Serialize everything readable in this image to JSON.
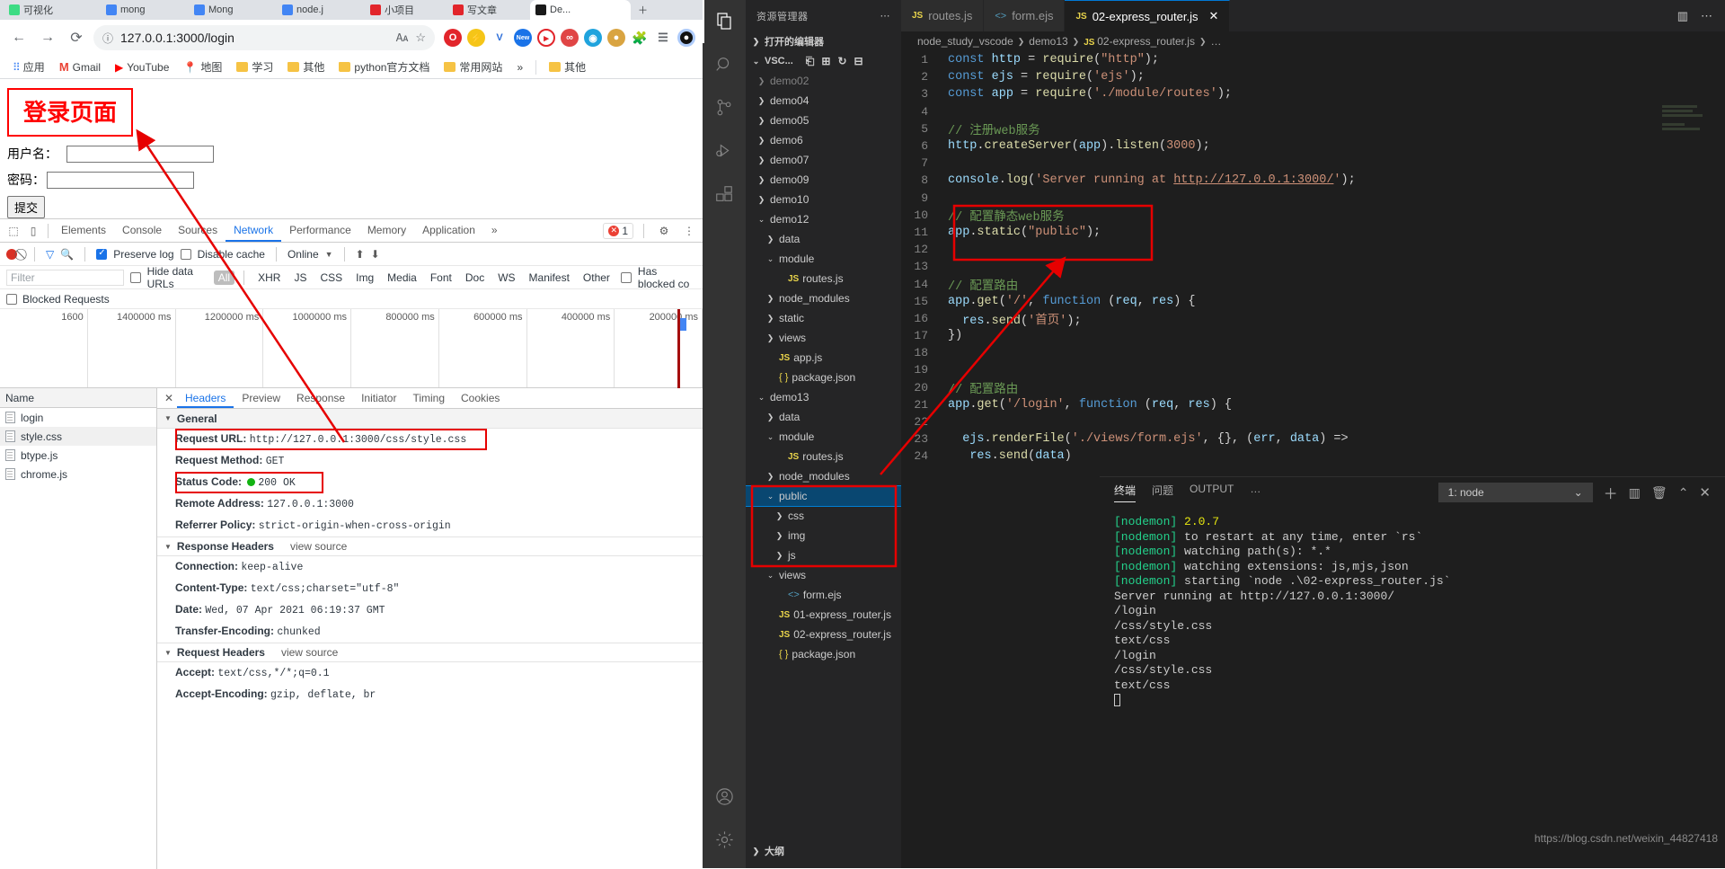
{
  "browser": {
    "tabs": [
      {
        "label": "可视化",
        "active": false
      },
      {
        "label": "mong",
        "active": false
      },
      {
        "label": "Mong",
        "active": false
      },
      {
        "label": "node.j",
        "active": false
      },
      {
        "label": "小项目",
        "active": false
      },
      {
        "label": "写文章",
        "active": false
      },
      {
        "label": "De...",
        "active": true
      }
    ],
    "nav": {
      "back_icon": "back-arrow-icon",
      "forward_icon": "forward-arrow-icon",
      "reload_icon": "reload-icon",
      "info_icon": "info-circle-icon",
      "url": "127.0.0.1:3000/login",
      "translate_icon": "translate-icon",
      "star_icon": "star-icon"
    },
    "extensions": [
      "opera-icon",
      "flash-icon",
      "v-icon",
      "new-badge-icon",
      "circle-icon",
      "infinity-icon",
      "blue-icon",
      "cookie-icon",
      "puzzle-icon",
      "playlist-icon",
      "profile-icon"
    ],
    "bookmarks": [
      {
        "label": "应用",
        "icon": "apps-grid-icon"
      },
      {
        "label": "Gmail",
        "icon": "gmail-icon"
      },
      {
        "label": "YouTube",
        "icon": "youtube-icon"
      },
      {
        "label": "地图",
        "icon": "maps-icon"
      },
      {
        "label": "学习",
        "icon": "folder-icon"
      },
      {
        "label": "其他",
        "icon": "folder-icon"
      },
      {
        "label": "python官方文档",
        "icon": "folder-icon"
      },
      {
        "label": "常用网站",
        "icon": "folder-icon"
      },
      {
        "label": "»",
        "icon": "overflow-icon"
      },
      {
        "label": "其他",
        "icon": "folder-icon"
      }
    ]
  },
  "page": {
    "heading": "登录页面",
    "username_label": "用户名：",
    "password_label": "密码：",
    "username_value": "",
    "password_value": "",
    "submit_label": "提交"
  },
  "devtools": {
    "tabs": [
      {
        "label": "Elements",
        "selected": false
      },
      {
        "label": "Console",
        "selected": false
      },
      {
        "label": "Sources",
        "selected": false
      },
      {
        "label": "Network",
        "selected": true
      },
      {
        "label": "Performance",
        "selected": false
      },
      {
        "label": "Memory",
        "selected": false
      },
      {
        "label": "Application",
        "selected": false
      },
      {
        "label": "»",
        "selected": false
      }
    ],
    "error_count": "1",
    "toolbar": {
      "record_icon": "record-icon",
      "clear_icon": "clear-icon",
      "filter_icon": "filter-icon",
      "search_icon": "search-icon",
      "preserve_log_label": "Preserve log",
      "preserve_log_checked": true,
      "disable_cache_label": "Disable cache",
      "disable_cache_checked": false,
      "throttling_value": "Online",
      "import_icon": "import-arrow-icon",
      "export_icon": "export-arrow-icon"
    },
    "filterbar": {
      "filter_placeholder": "Filter",
      "hide_data_urls_label": "Hide data URLs",
      "hide_data_urls_checked": false,
      "types": [
        "All",
        "XHR",
        "JS",
        "CSS",
        "Img",
        "Media",
        "Font",
        "Doc",
        "WS",
        "Manifest",
        "Other"
      ],
      "selected_type": "All",
      "has_blocked_label": "Has blocked co",
      "has_blocked_checked": false
    },
    "blocked_requests_label": "Blocked Requests",
    "overview_ticks": [
      "200000 ms",
      "400000 ms",
      "600000 ms",
      "800000 ms",
      "1000000 ms",
      "1200000 ms",
      "1400000 ms",
      "1600"
    ],
    "requests_header": "Name",
    "requests": [
      {
        "name": "login",
        "selected": false
      },
      {
        "name": "style.css",
        "selected": true
      },
      {
        "name": "btype.js",
        "selected": false
      },
      {
        "name": "chrome.js",
        "selected": false
      }
    ],
    "detail_tabs": [
      {
        "label": "Headers",
        "selected": true
      },
      {
        "label": "Preview",
        "selected": false
      },
      {
        "label": "Response",
        "selected": false
      },
      {
        "label": "Initiator",
        "selected": false
      },
      {
        "label": "Timing",
        "selected": false
      },
      {
        "label": "Cookies",
        "selected": false
      }
    ],
    "general_title": "General",
    "general": [
      {
        "key": "Request URL:",
        "value": "http://127.0.0.1:3000/css/style.css",
        "highlight": true
      },
      {
        "key": "Request Method:",
        "value": "GET",
        "highlight": false
      },
      {
        "key": "Status Code:",
        "value": "200  OK",
        "highlight": true,
        "status_dot": true
      },
      {
        "key": "Remote Address:",
        "value": "127.0.0.1:3000",
        "highlight": false
      },
      {
        "key": "Referrer Policy:",
        "value": "strict-origin-when-cross-origin",
        "highlight": false
      }
    ],
    "response_headers_title": "Response Headers",
    "view_source_label": "view source",
    "response_headers": [
      {
        "key": "Connection:",
        "value": "keep-alive"
      },
      {
        "key": "Content-Type:",
        "value": "text/css;charset=\"utf-8\""
      },
      {
        "key": "Date:",
        "value": "Wed, 07 Apr 2021 06:19:37 GMT"
      },
      {
        "key": "Transfer-Encoding:",
        "value": "chunked"
      }
    ],
    "request_headers_title": "Request Headers",
    "request_headers": [
      {
        "key": "Accept:",
        "value": "text/css,*/*;q=0.1"
      },
      {
        "key": "Accept-Encoding:",
        "value": "gzip, deflate, br"
      }
    ]
  },
  "vscode": {
    "activity_items": [
      "files-icon",
      "search-icon",
      "source-control-icon",
      "run-debug-icon",
      "extensions-icon",
      "account-icon",
      "settings-gear-icon"
    ],
    "sidebar": {
      "title": "资源管理器",
      "more_icon": "ellipsis-icon",
      "open_editors_label": "打开的编辑器",
      "workspace_label": "VSC...",
      "tools": [
        "new-file-icon",
        "new-folder-icon",
        "refresh-icon",
        "collapse-all-icon"
      ],
      "outline_label": "大纲",
      "tree": [
        {
          "label": "demo02",
          "depth": 1,
          "type": "folder",
          "expanded": false,
          "clipped": true
        },
        {
          "label": "demo04",
          "depth": 1,
          "type": "folder",
          "expanded": false
        },
        {
          "label": "demo05",
          "depth": 1,
          "type": "folder",
          "expanded": false
        },
        {
          "label": "demo6",
          "depth": 1,
          "type": "folder",
          "expanded": false
        },
        {
          "label": "demo07",
          "depth": 1,
          "type": "folder",
          "expanded": false
        },
        {
          "label": "demo09",
          "depth": 1,
          "type": "folder",
          "expanded": false
        },
        {
          "label": "demo10",
          "depth": 1,
          "type": "folder",
          "expanded": false
        },
        {
          "label": "demo12",
          "depth": 1,
          "type": "folder",
          "expanded": true
        },
        {
          "label": "data",
          "depth": 2,
          "type": "folder",
          "expanded": false
        },
        {
          "label": "module",
          "depth": 2,
          "type": "folder",
          "expanded": true
        },
        {
          "label": "routes.js",
          "depth": 3,
          "type": "js"
        },
        {
          "label": "node_modules",
          "depth": 2,
          "type": "folder",
          "expanded": false
        },
        {
          "label": "static",
          "depth": 2,
          "type": "folder",
          "expanded": false
        },
        {
          "label": "views",
          "depth": 2,
          "type": "folder",
          "expanded": false
        },
        {
          "label": "app.js",
          "depth": 2,
          "type": "js"
        },
        {
          "label": "package.json",
          "depth": 2,
          "type": "json"
        },
        {
          "label": "demo13",
          "depth": 1,
          "type": "folder",
          "expanded": true
        },
        {
          "label": "data",
          "depth": 2,
          "type": "folder",
          "expanded": false
        },
        {
          "label": "module",
          "depth": 2,
          "type": "folder",
          "expanded": true
        },
        {
          "label": "routes.js",
          "depth": 3,
          "type": "js"
        },
        {
          "label": "node_modules",
          "depth": 2,
          "type": "folder",
          "expanded": false
        },
        {
          "label": "public",
          "depth": 2,
          "type": "folder",
          "expanded": true,
          "selected": true
        },
        {
          "label": "css",
          "depth": 3,
          "type": "folder",
          "expanded": false
        },
        {
          "label": "img",
          "depth": 3,
          "type": "folder",
          "expanded": false
        },
        {
          "label": "js",
          "depth": 3,
          "type": "folder",
          "expanded": false
        },
        {
          "label": "views",
          "depth": 2,
          "type": "folder",
          "expanded": true
        },
        {
          "label": "form.ejs",
          "depth": 3,
          "type": "ejs"
        },
        {
          "label": "01-express_router.js",
          "depth": 2,
          "type": "js"
        },
        {
          "label": "02-express_router.js",
          "depth": 2,
          "type": "js"
        },
        {
          "label": "package.json",
          "depth": 2,
          "type": "json"
        }
      ]
    },
    "editor_tabs": [
      {
        "label": "routes.js",
        "icon": "js-icon",
        "selected": false,
        "closable": false
      },
      {
        "label": "form.ejs",
        "icon": "ejs-icon",
        "selected": false,
        "closable": false
      },
      {
        "label": "02-express_router.js",
        "icon": "js-icon",
        "selected": true,
        "closable": true
      }
    ],
    "window_actions": [
      "split-editor-icon",
      "more-actions-icon"
    ],
    "breadcrumb": [
      "node_study_vscode",
      "demo13",
      "02-express_router.js",
      "…"
    ],
    "code_lines": [
      {
        "n": "1",
        "html": "<span class='kw'>const</span> <span class='vr'>http</span> <span class='pl'>=</span> <span class='fn'>require</span><span class='pl'>(</span><span class='str'>\"http\"</span><span class='pl'>);</span>"
      },
      {
        "n": "2",
        "html": "<span class='kw'>const</span> <span class='vr'>ejs</span> <span class='pl'>=</span> <span class='fn'>require</span><span class='pl'>(</span><span class='str'>'ejs'</span><span class='pl'>);</span>"
      },
      {
        "n": "3",
        "html": "<span class='kw'>const</span> <span class='vr'>app</span> <span class='pl'>=</span> <span class='fn'>require</span><span class='pl'>(</span><span class='str'>'./module/routes'</span><span class='pl'>);</span>"
      },
      {
        "n": "4",
        "html": ""
      },
      {
        "n": "5",
        "html": "<span class='cmt'>// 注册web服务</span>"
      },
      {
        "n": "6",
        "html": "<span class='vr'>http</span><span class='pl'>.</span><span class='fn'>createServer</span><span class='pl'>(</span><span class='vr'>app</span><span class='pl'>).</span><span class='fn'>listen</span><span class='pl'>(</span><span class='str'>3000</span><span class='pl'>);</span>"
      },
      {
        "n": "7",
        "html": ""
      },
      {
        "n": "8",
        "html": "<span class='vr'>console</span><span class='pl'>.</span><span class='fn'>log</span><span class='pl'>(</span><span class='str'>'Server running at </span><span class='lnk'>http://127.0.0.1:3000/</span><span class='str'>'</span><span class='pl'>);</span>"
      },
      {
        "n": "9",
        "html": ""
      },
      {
        "n": "10",
        "html": "<span class='cmt'>// 配置静态web服务</span>"
      },
      {
        "n": "11",
        "html": "<span class='vr'>app</span><span class='pl'>.</span><span class='fn'>static</span><span class='pl'>(</span><span class='str'>\"public\"</span><span class='pl'>);</span>"
      },
      {
        "n": "12",
        "html": ""
      },
      {
        "n": "13",
        "html": ""
      },
      {
        "n": "14",
        "html": "<span class='cmt'>// 配置路由</span>"
      },
      {
        "n": "15",
        "html": "<span class='vr'>app</span><span class='pl'>.</span><span class='fn'>get</span><span class='pl'>(</span><span class='str'>'/'</span><span class='pl'>, </span><span class='kw'>function</span> <span class='pl'>(</span><span class='vr'>req</span><span class='pl'>, </span><span class='vr'>res</span><span class='pl'>) {</span>"
      },
      {
        "n": "16",
        "html": "  <span class='vr'>res</span><span class='pl'>.</span><span class='fn'>send</span><span class='pl'>(</span><span class='str'>'首页'</span><span class='pl'>);</span>"
      },
      {
        "n": "17",
        "html": "<span class='pl'>})</span>"
      },
      {
        "n": "18",
        "html": ""
      },
      {
        "n": "19",
        "html": ""
      },
      {
        "n": "20",
        "html": "<span class='cmt'>// 配置路由</span>"
      },
      {
        "n": "21",
        "html": "<span class='vr'>app</span><span class='pl'>.</span><span class='fn'>get</span><span class='pl'>(</span><span class='str'>'/login'</span><span class='pl'>, </span><span class='kw'>function</span> <span class='pl'>(</span><span class='vr'>req</span><span class='pl'>, </span><span class='vr'>res</span><span class='pl'>) {</span>"
      },
      {
        "n": "22",
        "html": ""
      },
      {
        "n": "23",
        "html": "  <span class='vr'>ejs</span><span class='pl'>.</span><span class='fn'>renderFile</span><span class='pl'>(</span><span class='str'>'./views/form.ejs'</span><span class='pl'>, {}, (</span><span class='vr'>err</span><span class='pl'>, </span><span class='vr'>data</span><span class='pl'>) =></span>"
      },
      {
        "n": "24",
        "html": "   <span class='vr'>res</span><span class='pl'>.</span><span class='fn'>send</span><span class='pl'>(</span><span class='vr'>data</span><span class='pl'>)</span>"
      }
    ],
    "panel": {
      "tabs": [
        {
          "label": "终端",
          "selected": true
        },
        {
          "label": "问题",
          "selected": false
        },
        {
          "label": "OUTPUT",
          "selected": false
        },
        {
          "label": "…",
          "selected": false
        }
      ],
      "terminal_select": "1: node",
      "actions": [
        "add-terminal-icon",
        "split-terminal-icon",
        "trash-icon",
        "chevron-up-icon",
        "close-icon"
      ],
      "lines": [
        {
          "text": "[nodemon] 2.0.7",
          "style": "nodemon-ver"
        },
        {
          "text": "[nodemon] to restart at any time, enter `rs`",
          "style": "nodemon"
        },
        {
          "text": "[nodemon] watching path(s): *.*",
          "style": "nodemon"
        },
        {
          "text": "[nodemon] watching extensions: js,mjs,json",
          "style": "nodemon"
        },
        {
          "text": "[nodemon] starting `node .\\02-express_router.js`",
          "style": "nodemon-start"
        },
        {
          "text": "Server running at http://127.0.0.1:3000/",
          "style": "white"
        },
        {
          "text": "/login",
          "style": "white"
        },
        {
          "text": "/css/style.css",
          "style": "white"
        },
        {
          "text": "text/css",
          "style": "white"
        },
        {
          "text": "/login",
          "style": "white"
        },
        {
          "text": "/css/style.css",
          "style": "white"
        },
        {
          "text": "text/css",
          "style": "white"
        }
      ]
    },
    "watermark": "https://blog.csdn.net/weixin_44827418"
  },
  "colors": {
    "accent_blue": "#1a73e8",
    "annotation_red": "#e60000",
    "vscode_bg": "#1e1e1e",
    "vscode_sidebar": "#252526",
    "status_green": "#12b312"
  }
}
